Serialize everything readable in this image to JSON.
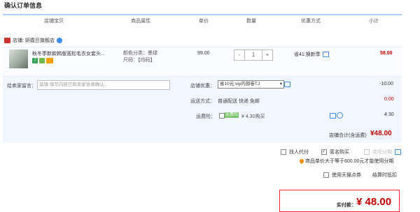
{
  "page": {
    "title": "确认订单信息"
  },
  "header": {
    "columns": [
      "店铺宝贝",
      "商品属性",
      "单价",
      "数量",
      "优惠方式",
      "小计"
    ]
  },
  "shop": {
    "name": "店铺: 妍霞旦旗舰店"
  },
  "item": {
    "title": "秋冬季新款韩版宽松毛衣女套头...",
    "color": "颜色分类：墨绿",
    "size": "尺码：【均码】",
    "price": "99.00",
    "qty_minus": "-",
    "qty_value": "1",
    "qty_plus": "+",
    "promo": "省41:换新季",
    "subtotal": "58.00",
    "badge_7": "7"
  },
  "extras": {
    "msg_label": "给卖家留言：",
    "msg_placeholder": "选填:填写内容已和卖家协商确认...",
    "discount_label": "店铺优惠：",
    "discount_value": "省10元:vip内部卷TJ",
    "discount_amount": "-10.00",
    "shipping_label": "运送方式：",
    "shipping_value": "普通配送 快递 免邮",
    "shipping_amount": "0.00",
    "insurance_label": "运费险：",
    "insurance_tag": "运费险",
    "insurance_value": "¥ 4.30购买",
    "insurance_amount": "4.30",
    "store_total_label": "店铺合计(含运费)",
    "store_total": "¥48.00"
  },
  "options": {
    "pay_for_me": "找人代付",
    "anonymous": "匿名购买",
    "huabei": "花呗分期",
    "notice": "商品单价大于等于600.00元才能使用分期",
    "tmall_points": "使用天猫点券",
    "points_note": "结算时抵扣"
  },
  "payment": {
    "label": "实付款：",
    "amount": "¥ 48.00"
  },
  "colors": {
    "accent_red": "#c40000",
    "header_line": "#b2d1ff",
    "panel_bg": "#f2f7ff"
  }
}
